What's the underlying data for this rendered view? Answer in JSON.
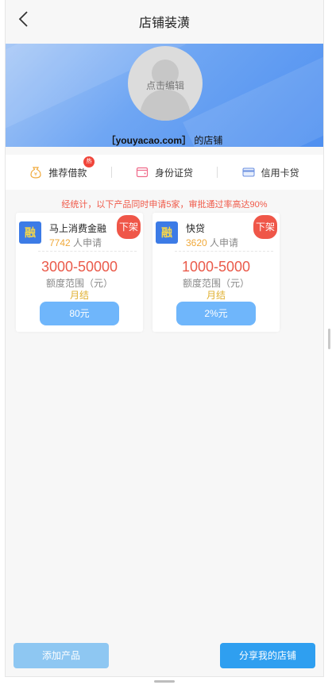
{
  "header": {
    "title": "店铺装潢"
  },
  "banner": {
    "avatar_label": "点击编辑",
    "shop_name": "［youyacao.com］",
    "shop_suffix": "的店铺"
  },
  "tabs": [
    {
      "label": "推荐借款",
      "icon": "money-bag-icon",
      "badge": "热"
    },
    {
      "label": "身份证贷",
      "icon": "wallet-icon"
    },
    {
      "label": "信用卡贷",
      "icon": "credit-card-icon"
    }
  ],
  "notice": "经统计，以下产品同时申请5家，审批通过率高达90%",
  "products": [
    {
      "logo": "融",
      "name": "马上消费金融",
      "applicants": "7742",
      "applicants_suffix": "人申请",
      "off_label": "下架",
      "range": "3000-50000",
      "range_label": "额度范围（元）",
      "term": "月结",
      "fee": "80元"
    },
    {
      "logo": "融",
      "name": "快贷",
      "applicants": "3620",
      "applicants_suffix": "人申请",
      "off_label": "下架",
      "range": "1000-5000",
      "range_label": "额度范围（元）",
      "term": "月结",
      "fee": "2%元"
    }
  ],
  "footer": {
    "add_label": "添加产品",
    "share_label": "分享我的店铺"
  },
  "colors": {
    "accent": "#2f9ff0",
    "danger": "#ef5648",
    "warning": "#e0b030"
  }
}
